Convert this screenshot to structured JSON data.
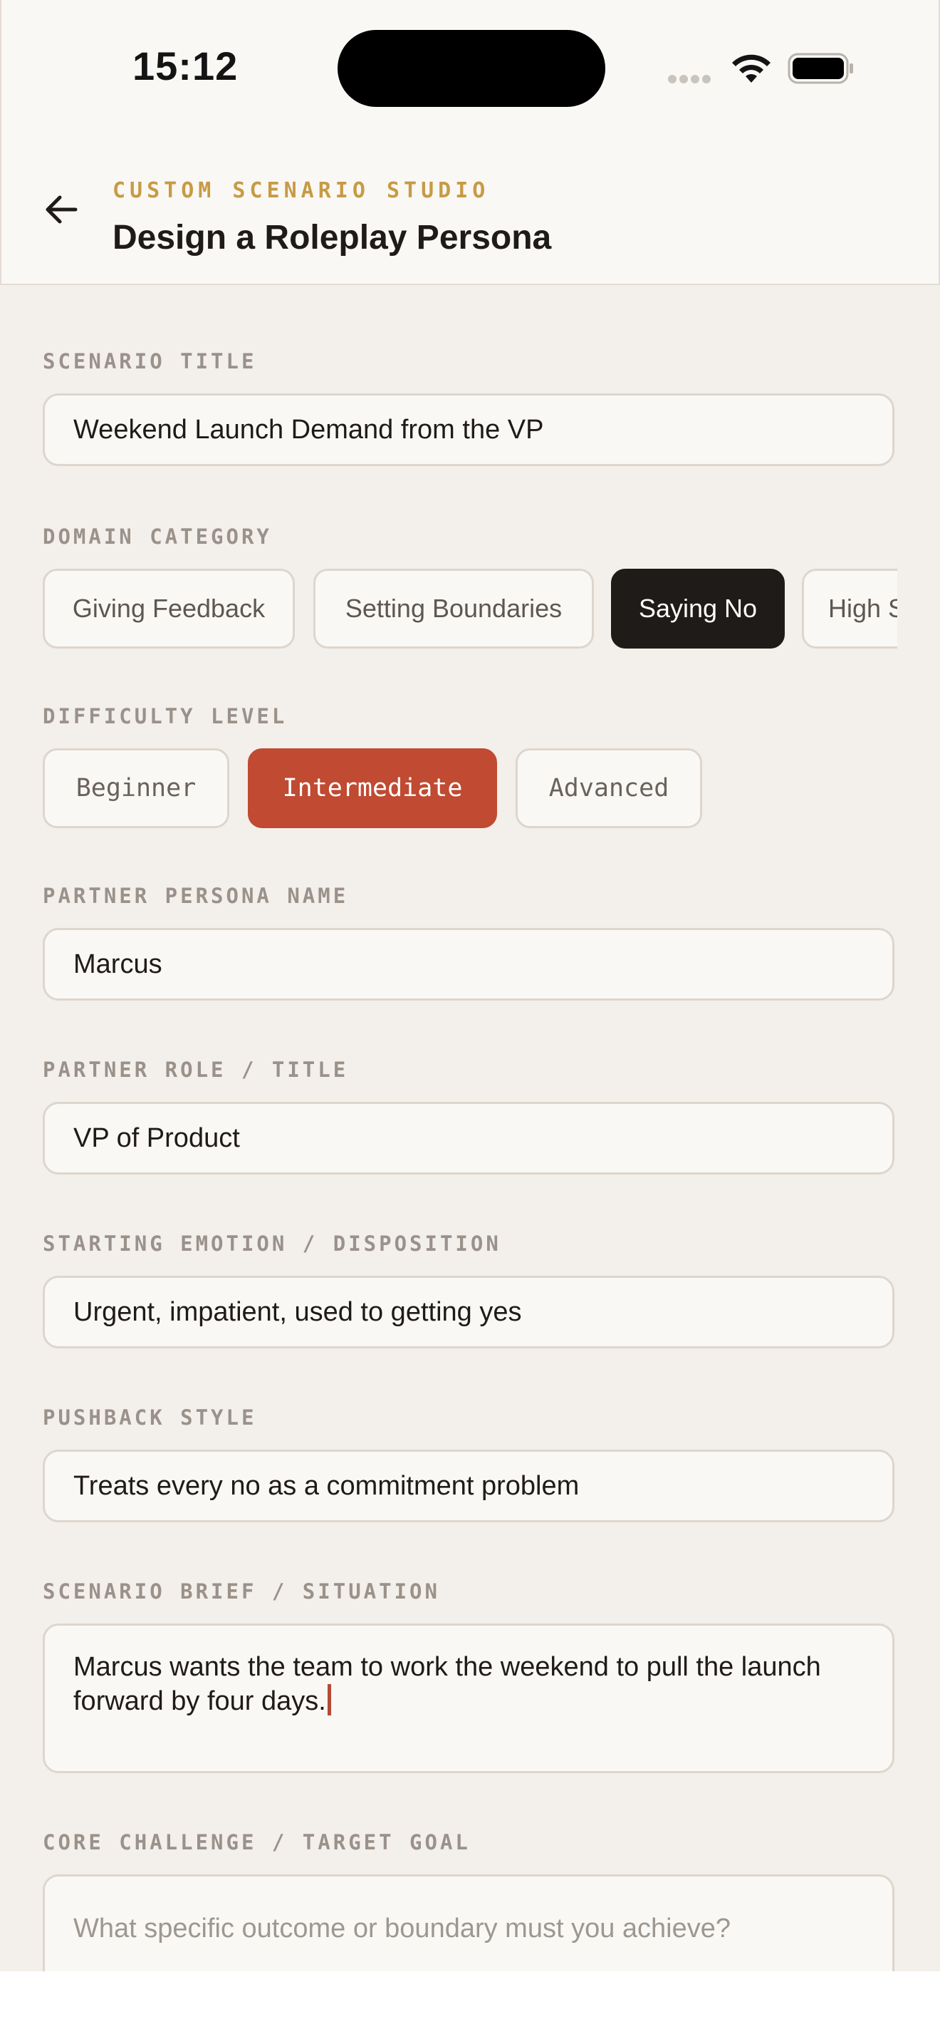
{
  "status_bar": {
    "time": "15:12"
  },
  "header": {
    "kicker": "CUSTOM SCENARIO STUDIO",
    "title": "Design a Roleplay Persona"
  },
  "form": {
    "scenario_title": {
      "label": "SCENARIO TITLE",
      "value": "Weekend Launch Demand from the VP"
    },
    "domain_category": {
      "label": "DOMAIN CATEGORY",
      "options": [
        "Giving Feedback",
        "Setting Boundaries",
        "Saying No",
        "High S"
      ],
      "selected": "Saying No"
    },
    "difficulty": {
      "label": "DIFFICULTY LEVEL",
      "options": [
        "Beginner",
        "Intermediate",
        "Advanced"
      ],
      "selected": "Intermediate"
    },
    "partner_name": {
      "label": "PARTNER PERSONA NAME",
      "value": "Marcus"
    },
    "partner_role": {
      "label": "PARTNER ROLE / TITLE",
      "value": "VP of Product"
    },
    "starting_emotion": {
      "label": "STARTING EMOTION / DISPOSITION",
      "value": "Urgent, impatient, used to getting yes"
    },
    "pushback_style": {
      "label": "PUSHBACK STYLE",
      "value": "Treats every no as a commitment problem"
    },
    "scenario_brief": {
      "label": "SCENARIO BRIEF / SITUATION",
      "value": "Marcus wants the team to work the weekend to pull the launch forward by four days."
    },
    "core_challenge": {
      "label": "CORE CHALLENGE / TARGET GOAL",
      "placeholder": "What specific outcome or boundary must you achieve?"
    }
  },
  "colors": {
    "background": "#f3efea",
    "accent_gold": "#c79b45",
    "accent_red": "#c04a32",
    "dark_chip": "#1f1b18"
  },
  "icons": [
    "back-arrow-icon",
    "cellular-signal-icon",
    "wifi-icon",
    "battery-icon"
  ]
}
